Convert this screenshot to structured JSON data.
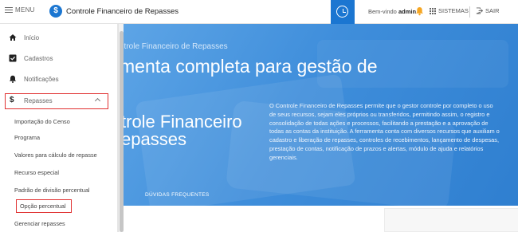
{
  "topbar": {
    "menu_label": "MENU",
    "logo_glyph": "$",
    "app_title": "Controle Financeiro de Repasses",
    "welcome_prefix": "Bem-vindo",
    "user": "admin",
    "sistemas_label": "SISTEMAS",
    "sair_label": "SAIR",
    "accent": "#1b76d1"
  },
  "sidebar": {
    "items": [
      {
        "label": "Início",
        "icon": "home-icon"
      },
      {
        "label": "Cadastros",
        "icon": "checkbox-icon"
      },
      {
        "label": "Notificações",
        "icon": "bell-icon"
      },
      {
        "label": "Repasses",
        "icon": "dollar-icon"
      }
    ],
    "repasses_submenu": [
      "Importação do Censo",
      "Programa",
      "Valores para cálculo de repasse",
      "Recurso especial",
      "Padrão de divisão percentual",
      "Opção percentual",
      "Gerenciar repasses"
    ]
  },
  "hero": {
    "subtitle": "ntrole Financeiro de Repasses",
    "title": "menta completa para gestão de",
    "big_title": "trole Financeiro Repasses",
    "big_title_line1": "trole Financeiro",
    "big_title_line2": "epasses",
    "description": "O Controle Financeiro de Repasses permite que o gestor controle por completo o uso de seus recursos, sejam eles próprios ou transferidos, permitindo assim, o registro e consolidação de todas ações e processos, facilitando a prestação e a aprovação de todas as contas da instituição. A ferramenta conta com diversos recursos que auxiliam o cadastro e liberação de repasses, controles de recebimentos, lançamento de despesas, prestação de contas, notificação de prazos e alertas, módulo de ajuda e relatórios gerenciais.",
    "faq_label": "DÚVIDAS FREQUENTES"
  },
  "colors": {
    "highlight_border": "#e03131",
    "hero_blue": "#3f8edb"
  }
}
